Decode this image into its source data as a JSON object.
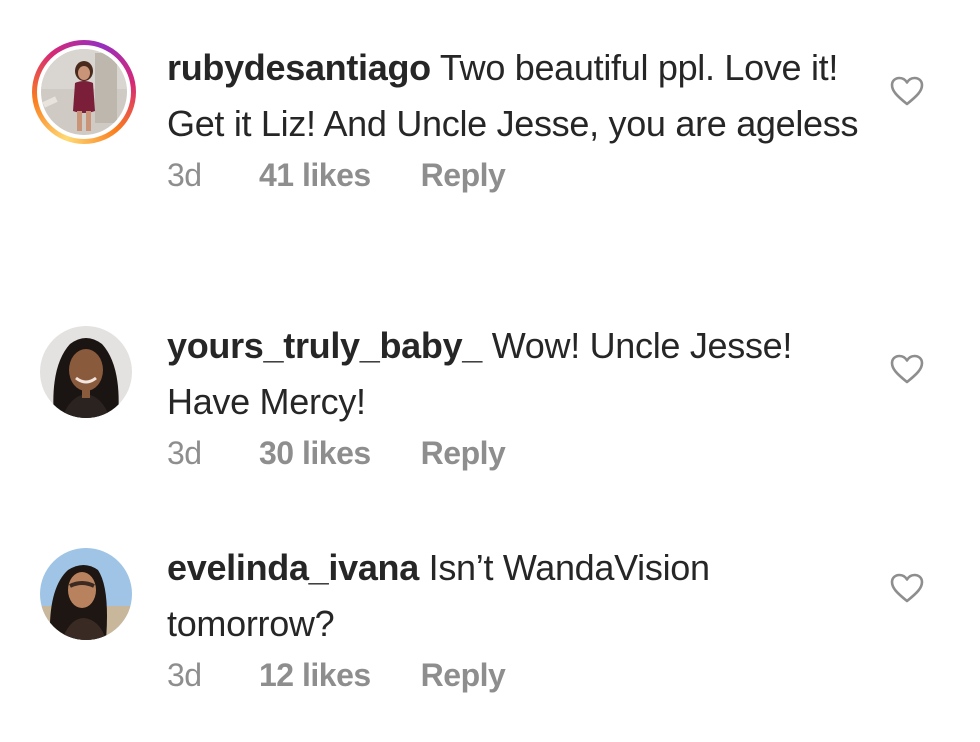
{
  "comments": [
    {
      "username": "rubydesantiago",
      "text": " Two beautiful ppl. Love it! Get it Liz! And Uncle Jesse, you are ageless",
      "age": "3d",
      "likes": "41 likes",
      "reply": "Reply",
      "has_story_ring": true
    },
    {
      "username": "yours_truly_baby_",
      "text": " Wow!  Uncle Jesse! Have Mercy!",
      "age": "3d",
      "likes": "30 likes",
      "reply": "Reply",
      "has_story_ring": false
    },
    {
      "username": "evelinda_ivana",
      "text": " Isn’t WandaVision tomorrow?",
      "age": "3d",
      "likes": "12 likes",
      "reply": "Reply",
      "has_story_ring": false
    }
  ],
  "icons": {
    "like": "heart-outline-icon"
  },
  "colors": {
    "primary_text": "#262626",
    "secondary_text": "#8e8e8e",
    "icon": "#8e8e8e"
  }
}
